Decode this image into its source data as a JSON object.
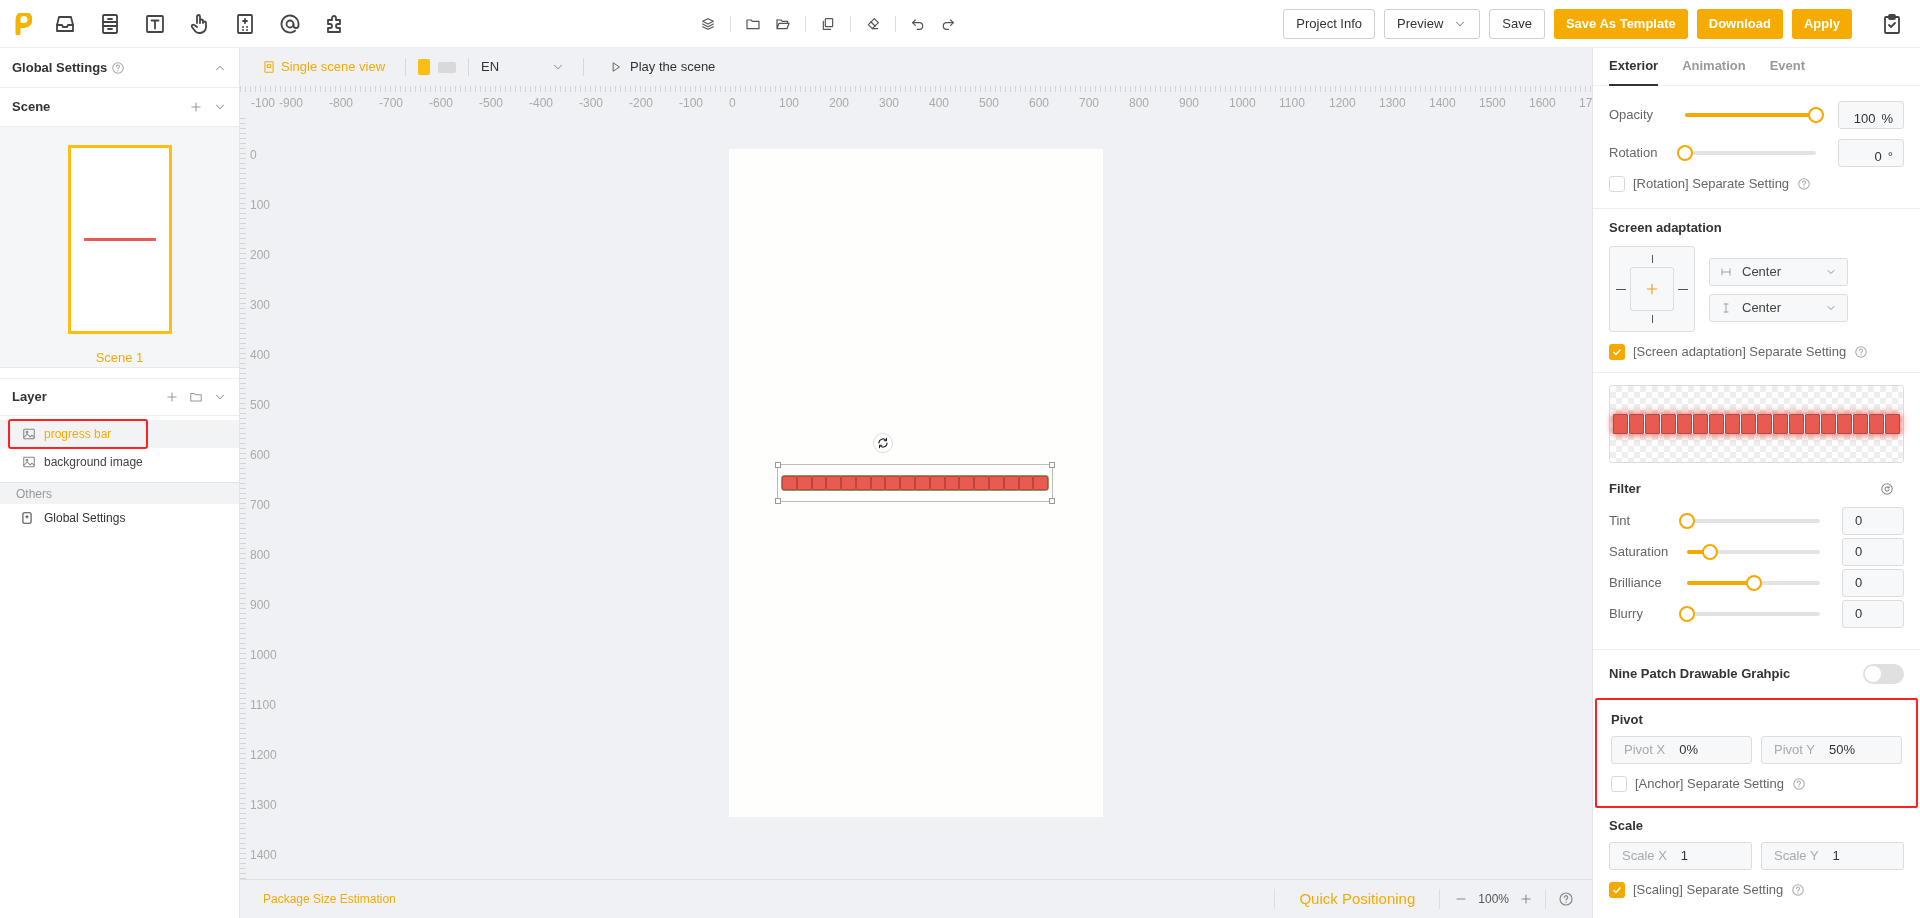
{
  "top_buttons": [
    {
      "label": "Project Info",
      "kind": "outline"
    },
    {
      "label": "Preview",
      "kind": "dropdown"
    },
    {
      "label": "Save",
      "kind": "outline"
    },
    {
      "label": "Save As Template",
      "kind": "primary"
    },
    {
      "label": "Download",
      "kind": "primary"
    },
    {
      "label": "Apply",
      "kind": "primary"
    }
  ],
  "left_panel": {
    "global_settings_title": "Global Settings",
    "scene_title": "Scene",
    "scenes": [
      {
        "label": "Scene 1",
        "selected": true
      }
    ],
    "layer_title": "Layer",
    "layers": [
      {
        "label": "progress bar",
        "selected": true,
        "annotated": true
      },
      {
        "label": "background image",
        "selected": false,
        "annotated": false
      }
    ],
    "others_title": "Others",
    "others": [
      {
        "label": "Global Settings"
      }
    ]
  },
  "canvas_toolbar": {
    "view_mode": "Single scene view",
    "orientations": [
      {
        "selected": true
      },
      {
        "selected": false
      }
    ],
    "language": "EN",
    "play": "Play the scene"
  },
  "ruler": {
    "x_labels": [
      "-100",
      "-900",
      "-800",
      "-700",
      "-600",
      "-500",
      "-400",
      "-300",
      "-200",
      "-100",
      "0",
      "100",
      "200",
      "300",
      "400",
      "500",
      "600",
      "700",
      "800",
      "900",
      "1000",
      "1100",
      "1200",
      "1300",
      "1400",
      "1500",
      "1600",
      "17"
    ],
    "y_labels": [
      "0",
      "100",
      "200",
      "300",
      "400",
      "500",
      "600",
      "700",
      "800",
      "900",
      "1000",
      "1100",
      "1200",
      "1300",
      "1400"
    ]
  },
  "footer": {
    "package_size": "Package Size Estimation",
    "quick_positioning": "Quick Positioning",
    "zoom": "100%"
  },
  "right_panel": {
    "tabs": [
      {
        "label": "Exterior",
        "selected": true
      },
      {
        "label": "Animation",
        "selected": false
      },
      {
        "label": "Event",
        "selected": false
      }
    ],
    "transform": [
      {
        "label": "Opacity",
        "level": 1,
        "value": "100",
        "unit": "%"
      },
      {
        "label": "Rotation",
        "level": 0,
        "value": "0",
        "unit": "°"
      }
    ],
    "rotation_separate": {
      "label": "[Rotation] Separate Setting",
      "checked": false
    },
    "screen_adaptation": {
      "title": "Screen adaptation",
      "horizontal": "Center",
      "vertical": "Center",
      "separate": {
        "label": "[Screen adaptation] Separate Setting",
        "checked": true
      }
    },
    "filter": {
      "title": "Filter",
      "sliders": [
        {
          "label": "Tint",
          "level": 0,
          "value": "0"
        },
        {
          "label": "Saturation",
          "level": 0.17,
          "value": "0"
        },
        {
          "label": "Brilliance",
          "level": 0.5,
          "value": "0"
        },
        {
          "label": "Blurry",
          "level": 0,
          "value": "0"
        }
      ]
    },
    "nine_patch": {
      "label": "Nine Patch Drawable Grahpic",
      "on": false
    },
    "pivot": {
      "title": "Pivot",
      "annotated": true,
      "fields": [
        {
          "label": "Pivot X",
          "value": "0%"
        },
        {
          "label": "Pivot Y",
          "value": "50%"
        }
      ],
      "separate": {
        "label": "[Anchor] Separate Setting",
        "checked": false
      }
    },
    "scale": {
      "title": "Scale",
      "fields": [
        {
          "label": "Scale X",
          "value": "1"
        },
        {
          "label": "Scale Y",
          "value": "1"
        }
      ],
      "separate": {
        "label": "[Scaling] Separate Setting",
        "checked": true
      }
    }
  }
}
